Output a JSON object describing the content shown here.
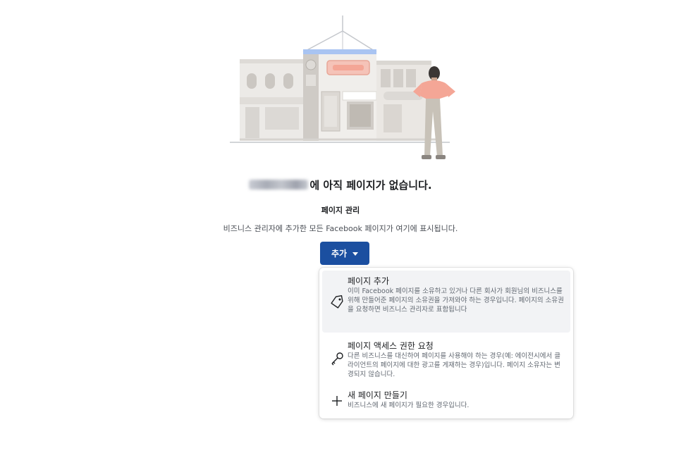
{
  "empty_state": {
    "heading_suffix": "에 아직 페이지가 없습니다.",
    "subtitle": "페이지 관리",
    "description": "비즈니스 관리자에 추가한 모든 Facebook 페이지가 여기에 표시됩니다."
  },
  "add_button": {
    "label": "추가",
    "icon": "caret-down-icon"
  },
  "dropdown": {
    "items": [
      {
        "icon": "tag-icon",
        "title": "페이지 추가",
        "description": "이미 Facebook 페이지를 소유하고 있거나 다른 회사가 회원님의 비즈니스를 위해 만들어준 페이지의 소유권을 가져와야 하는 경우입니다. 페이지의 소유권을 요청하면 비즈니스 관리자로 표함됩니다"
      },
      {
        "icon": "key-icon",
        "title": "페이지 액세스 권한 요청",
        "description": "다른 비즈니스를 대신하여 페이지를 사용해야 하는 경우(예: 에이전시에서 클라이언트의 페이지에 대한 광고를 게재하는 경우)입니다. 페이지 소유자는 변경되지 않습니다."
      },
      {
        "icon": "plus-icon",
        "title": "새 페이지 만들기",
        "description": "비즈니스에 새 페이지가 필요한 경우입니다."
      }
    ]
  },
  "colors": {
    "primary_button": "#1b4fa0",
    "hover_row": "#f2f3f5"
  }
}
